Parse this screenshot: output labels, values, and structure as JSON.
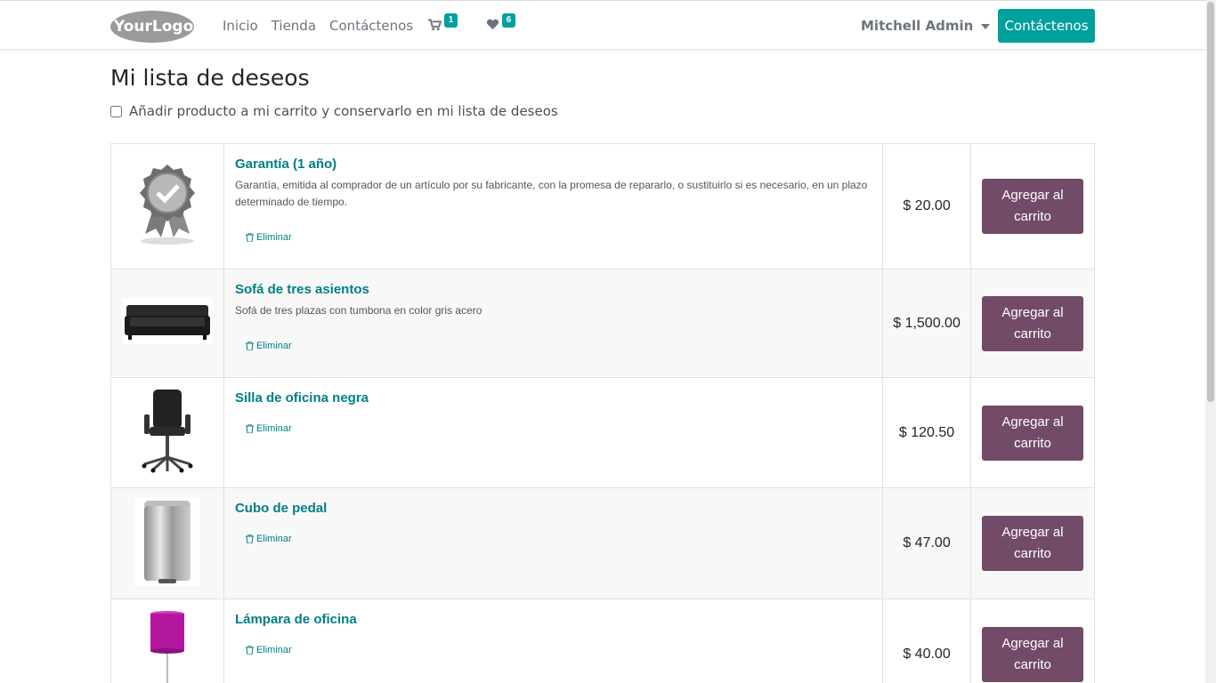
{
  "header": {
    "logo_text": "YourLogo",
    "nav": [
      {
        "label": "Inicio"
      },
      {
        "label": "Tienda"
      },
      {
        "label": "Contáctenos"
      }
    ],
    "cart_count": "1",
    "wishlist_count": "6",
    "user_name": "Mitchell Admin",
    "cta_label": "Contáctenos"
  },
  "colors": {
    "accent": "#00A09D",
    "link": "#017E84",
    "primary_button": "#714B67"
  },
  "page": {
    "title": "Mi lista de deseos",
    "keep_option_label": "Añadir producto a mi carrito y conservarlo en mi lista de deseos"
  },
  "wishlist": {
    "remove_label": "Eliminar",
    "add_label": "Agregar al carrito",
    "items": [
      {
        "name": "Garantía (1 año)",
        "description": "Garantía, emitida al comprador de un artículo por su fabricante, con la promesa de repararlo, o sustituirlo si es necesario, en un plazo determinado de tiempo.",
        "price": "$ 20.00",
        "image": "warranty-badge"
      },
      {
        "name": "Sofá de tres asientos",
        "description": "Sofá de tres plazas con tumbona en color gris acero",
        "price": "$ 1,500.00",
        "image": "sofa"
      },
      {
        "name": "Silla de oficina negra",
        "description": "",
        "price": "$ 120.50",
        "image": "office-chair"
      },
      {
        "name": "Cubo de pedal",
        "description": "",
        "price": "$ 47.00",
        "image": "pedal-bin"
      },
      {
        "name": "Lámpara de oficina",
        "description": "",
        "price": "$ 40.00",
        "image": "office-lamp"
      }
    ]
  }
}
